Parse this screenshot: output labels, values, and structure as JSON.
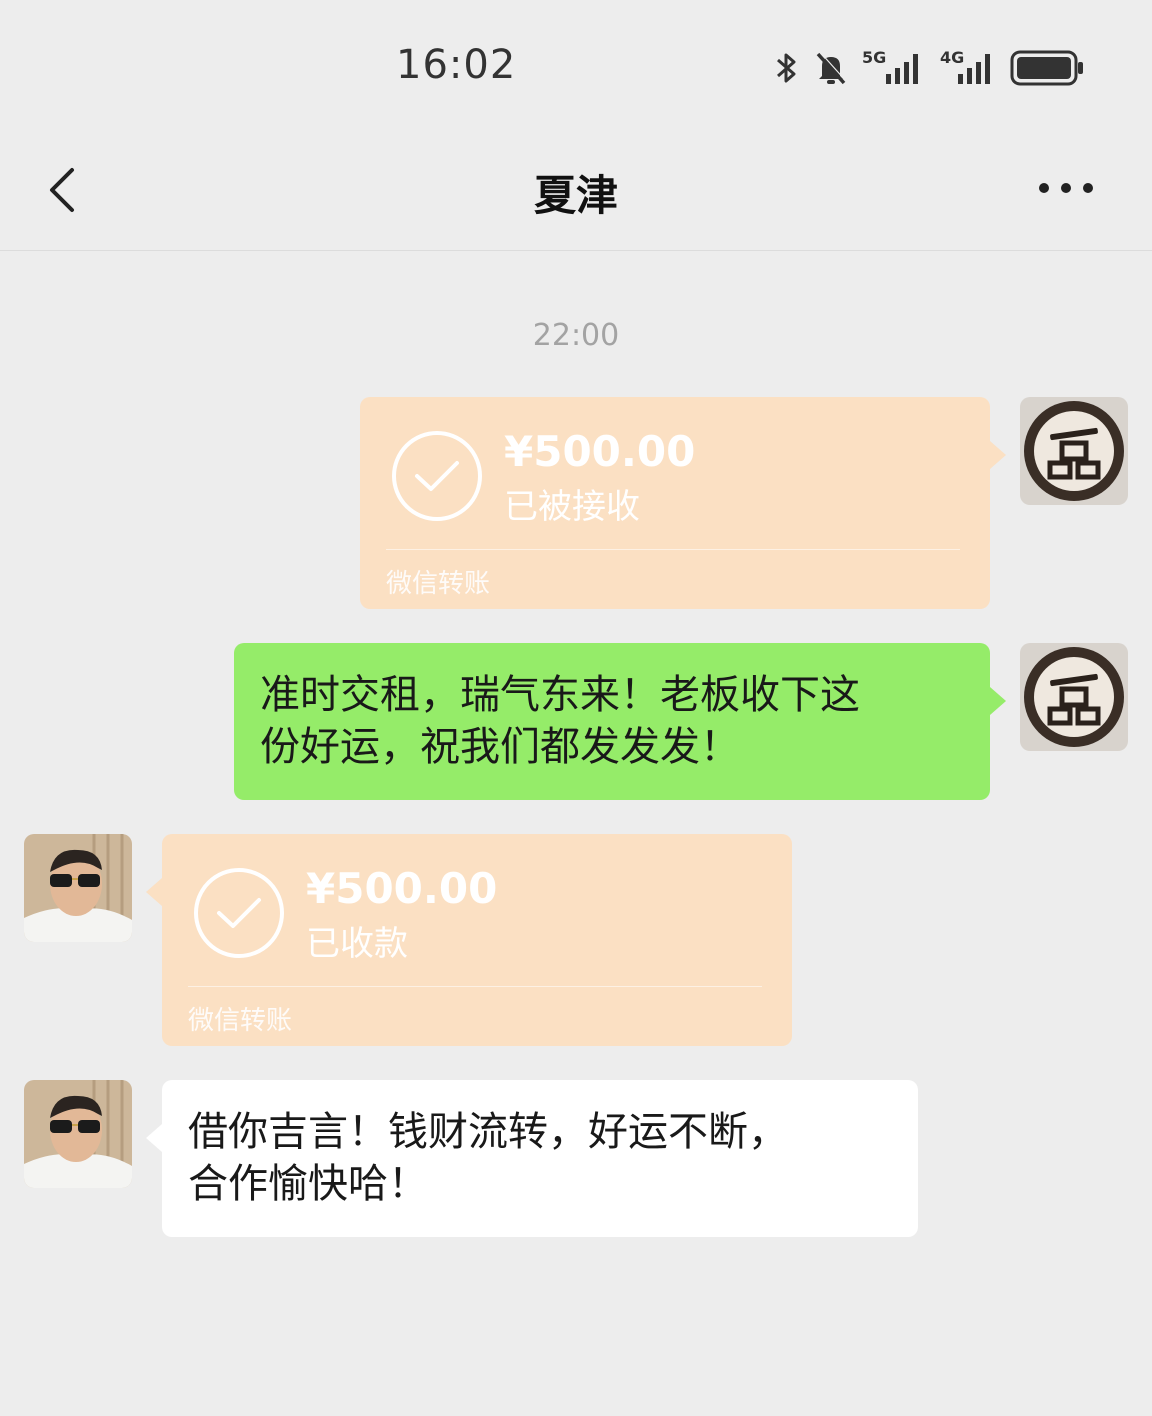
{
  "status_bar": {
    "time": "16:02",
    "network_5g": "5G",
    "network_4g": "4G",
    "icons": [
      "bluetooth-icon",
      "mute-bell-icon",
      "signal-5g-icon",
      "signal-4g-icon",
      "battery-icon"
    ]
  },
  "header": {
    "back_icon": "chevron-left-icon",
    "title": "夏津",
    "more_icon": "more-dots-icon"
  },
  "chat": {
    "timestamp": "22:00",
    "messages": [
      {
        "side": "right",
        "type": "transfer",
        "amount": "¥500.00",
        "status": "已被接收",
        "caption": "微信转账"
      },
      {
        "side": "right",
        "type": "text",
        "lines": [
          "准时交租，瑞气东来！老板收下这",
          "份好运，祝我们都发发发！"
        ]
      },
      {
        "side": "left",
        "type": "transfer",
        "amount": "¥500.00",
        "status": "已收款",
        "caption": "微信转账"
      },
      {
        "side": "left",
        "type": "text",
        "lines": [
          "借你吉言！钱财流转，好运不断，",
          "合作愉快哈！"
        ]
      }
    ]
  },
  "colors": {
    "background": "#ededed",
    "transfer_bubble": "#fbe0c3",
    "own_text_bubble": "#95ec69",
    "other_text_bubble": "#ffffff",
    "timestamp": "#a3a3a3"
  }
}
